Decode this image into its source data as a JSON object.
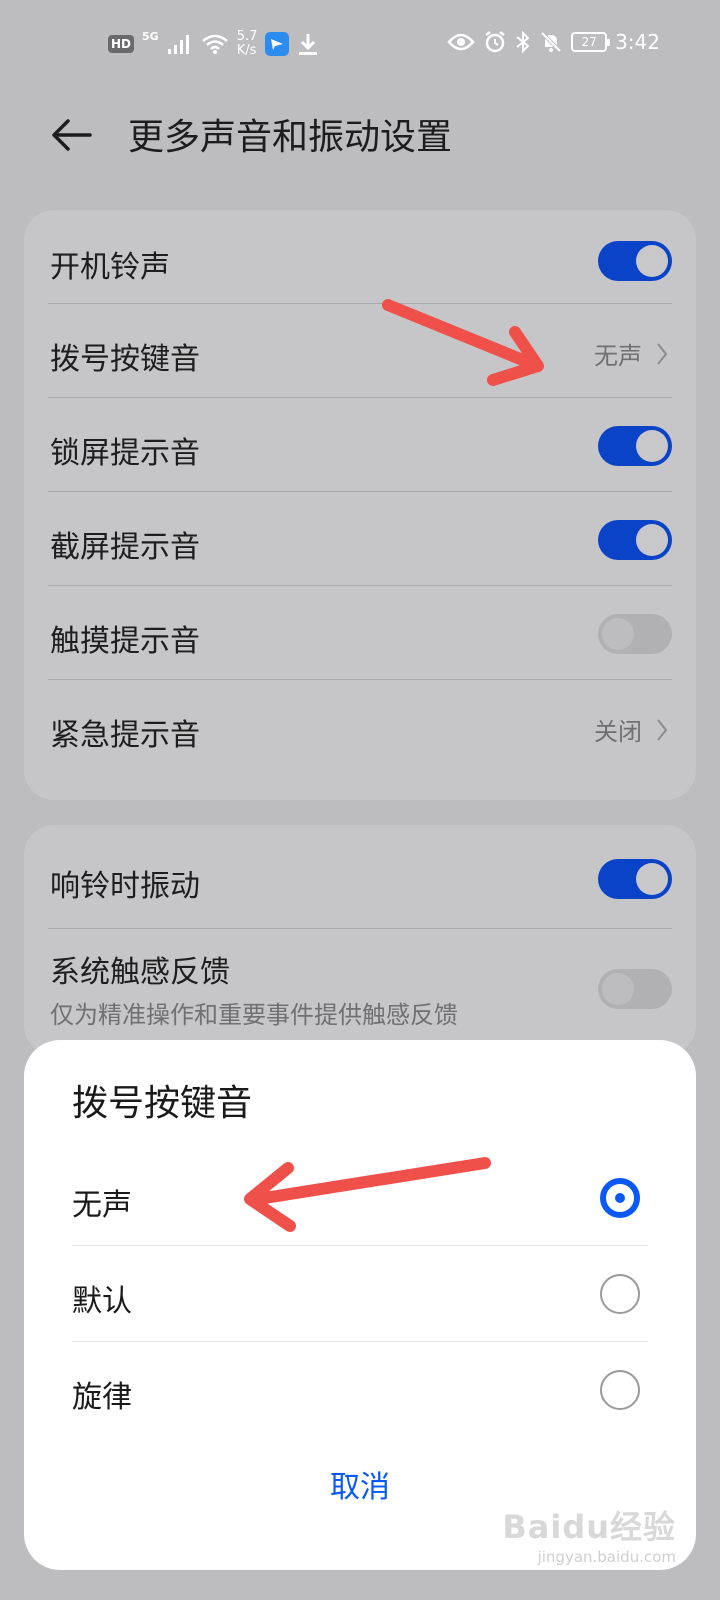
{
  "status_bar": {
    "hd_badge": "HD",
    "network": "5G",
    "speed_value": "5.7",
    "speed_unit": "K/s",
    "battery": "27",
    "time": "3:42"
  },
  "header": {
    "title": "更多声音和振动设置"
  },
  "settings_group_1": [
    {
      "label": "开机铃声",
      "type": "toggle",
      "on": true
    },
    {
      "label": "拨号按键音",
      "type": "link",
      "value": "无声"
    },
    {
      "label": "锁屏提示音",
      "type": "toggle",
      "on": true
    },
    {
      "label": "截屏提示音",
      "type": "toggle",
      "on": true
    },
    {
      "label": "触摸提示音",
      "type": "toggle",
      "on": false
    },
    {
      "label": "紧急提示音",
      "type": "link",
      "value": "关闭"
    }
  ],
  "settings_group_2": [
    {
      "label": "响铃时振动",
      "type": "toggle",
      "on": true
    },
    {
      "label": "系统触感反馈",
      "sublabel": "仅为精准操作和重要事件提供触感反馈",
      "type": "toggle",
      "on": false
    }
  ],
  "dialog": {
    "title": "拨号按键音",
    "options": [
      {
        "label": "无声",
        "selected": true
      },
      {
        "label": "默认",
        "selected": false
      },
      {
        "label": "旋律",
        "selected": false
      }
    ],
    "cancel_label": "取消"
  },
  "colors": {
    "accent": "#0a59f7",
    "toggle_on": "#0a42c8",
    "annotation_arrow": "#f0504a"
  },
  "watermark": {
    "logo": "Baidu经验",
    "url": "jingyan.baidu.com"
  }
}
